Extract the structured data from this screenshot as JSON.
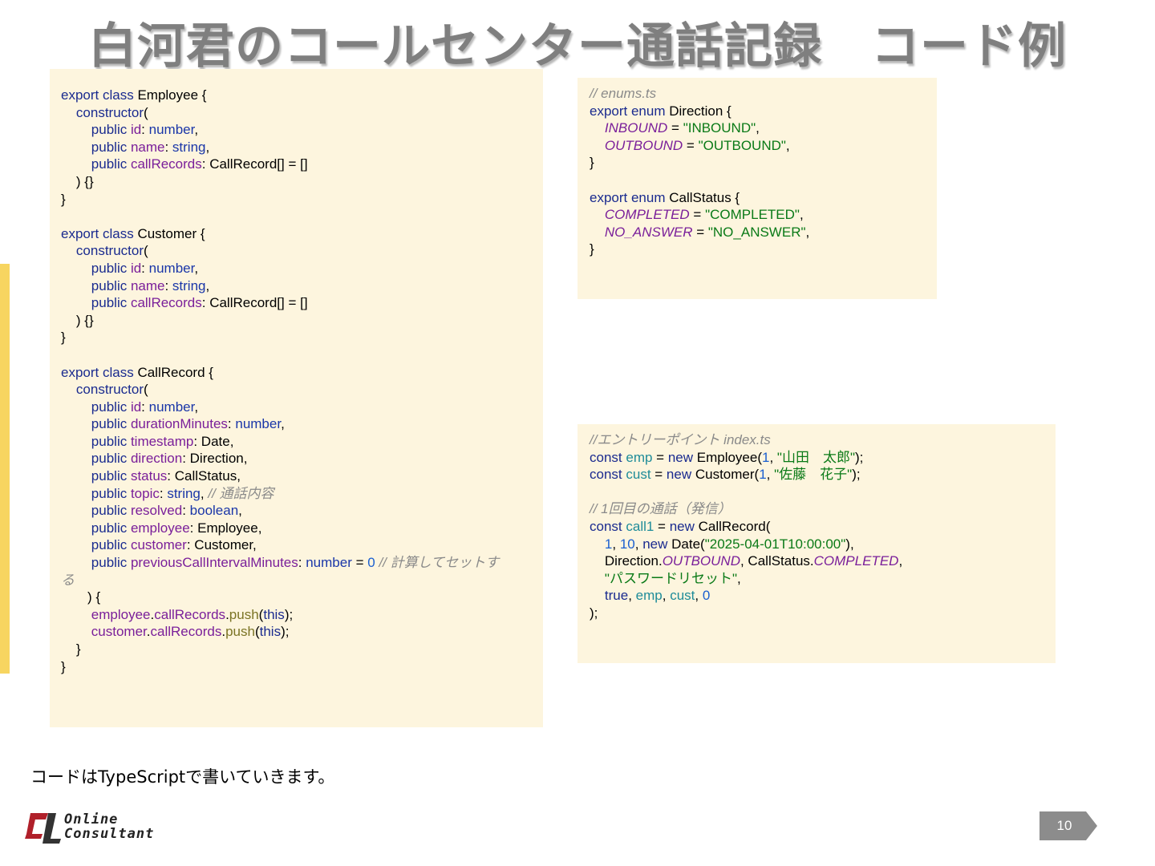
{
  "slide": {
    "title": "白河君のコールセンター通話記録　コード例",
    "caption": "コードはTypeScriptで書いていきます。",
    "page_number": "10",
    "logo": {
      "line1": "Online",
      "line2": "Consultant"
    },
    "accent_color": "#f7d560",
    "panel_color": "#fdf5de"
  },
  "code_classes": {
    "lines": [
      [
        {
          "t": "export class ",
          "c": "kw"
        },
        {
          "t": "Employee {"
        }
      ],
      [
        {
          "t": "    "
        },
        {
          "t": "constructor",
          "c": "kw"
        },
        {
          "t": "("
        }
      ],
      [
        {
          "t": "        "
        },
        {
          "t": "public ",
          "c": "kw"
        },
        {
          "t": "id",
          "c": "pr"
        },
        {
          "t": ": "
        },
        {
          "t": "number",
          "c": "ty"
        },
        {
          "t": ","
        }
      ],
      [
        {
          "t": "        "
        },
        {
          "t": "public ",
          "c": "kw"
        },
        {
          "t": "name",
          "c": "pr"
        },
        {
          "t": ": "
        },
        {
          "t": "string",
          "c": "ty"
        },
        {
          "t": ","
        }
      ],
      [
        {
          "t": "        "
        },
        {
          "t": "public ",
          "c": "kw"
        },
        {
          "t": "callRecords",
          "c": "pr"
        },
        {
          "t": ": CallRecord[] = []"
        }
      ],
      [
        {
          "t": "    ) {}"
        }
      ],
      [
        {
          "t": "}"
        }
      ],
      [],
      [
        {
          "t": "export class ",
          "c": "kw"
        },
        {
          "t": "Customer {"
        }
      ],
      [
        {
          "t": "    "
        },
        {
          "t": "constructor",
          "c": "kw"
        },
        {
          "t": "("
        }
      ],
      [
        {
          "t": "        "
        },
        {
          "t": "public ",
          "c": "kw"
        },
        {
          "t": "id",
          "c": "pr"
        },
        {
          "t": ": "
        },
        {
          "t": "number",
          "c": "ty"
        },
        {
          "t": ","
        }
      ],
      [
        {
          "t": "        "
        },
        {
          "t": "public ",
          "c": "kw"
        },
        {
          "t": "name",
          "c": "pr"
        },
        {
          "t": ": "
        },
        {
          "t": "string",
          "c": "ty"
        },
        {
          "t": ","
        }
      ],
      [
        {
          "t": "        "
        },
        {
          "t": "public ",
          "c": "kw"
        },
        {
          "t": "callRecords",
          "c": "pr"
        },
        {
          "t": ": CallRecord[] = []"
        }
      ],
      [
        {
          "t": "    ) {}"
        }
      ],
      [
        {
          "t": "}"
        }
      ],
      [],
      [
        {
          "t": "export class ",
          "c": "kw"
        },
        {
          "t": "CallRecord {"
        }
      ],
      [
        {
          "t": "    "
        },
        {
          "t": "constructor",
          "c": "kw"
        },
        {
          "t": "("
        }
      ],
      [
        {
          "t": "        "
        },
        {
          "t": "public ",
          "c": "kw"
        },
        {
          "t": "id",
          "c": "pr"
        },
        {
          "t": ": "
        },
        {
          "t": "number",
          "c": "ty"
        },
        {
          "t": ","
        }
      ],
      [
        {
          "t": "        "
        },
        {
          "t": "public ",
          "c": "kw"
        },
        {
          "t": "durationMinutes",
          "c": "pr"
        },
        {
          "t": ": "
        },
        {
          "t": "number",
          "c": "ty"
        },
        {
          "t": ","
        }
      ],
      [
        {
          "t": "        "
        },
        {
          "t": "public ",
          "c": "kw"
        },
        {
          "t": "timestamp",
          "c": "pr"
        },
        {
          "t": ": Date,"
        }
      ],
      [
        {
          "t": "        "
        },
        {
          "t": "public ",
          "c": "kw"
        },
        {
          "t": "direction",
          "c": "pr"
        },
        {
          "t": ": Direction,"
        }
      ],
      [
        {
          "t": "        "
        },
        {
          "t": "public ",
          "c": "kw"
        },
        {
          "t": "status",
          "c": "pr"
        },
        {
          "t": ": CallStatus,"
        }
      ],
      [
        {
          "t": "        "
        },
        {
          "t": "public ",
          "c": "kw"
        },
        {
          "t": "topic",
          "c": "pr"
        },
        {
          "t": ": "
        },
        {
          "t": "string",
          "c": "ty"
        },
        {
          "t": ", "
        },
        {
          "t": "// 通話内容",
          "c": "cm"
        }
      ],
      [
        {
          "t": "        "
        },
        {
          "t": "public ",
          "c": "kw"
        },
        {
          "t": "resolved",
          "c": "pr"
        },
        {
          "t": ": "
        },
        {
          "t": "boolean",
          "c": "ty"
        },
        {
          "t": ","
        }
      ],
      [
        {
          "t": "        "
        },
        {
          "t": "public ",
          "c": "kw"
        },
        {
          "t": "employee",
          "c": "pr"
        },
        {
          "t": ": Employee,"
        }
      ],
      [
        {
          "t": "        "
        },
        {
          "t": "public ",
          "c": "kw"
        },
        {
          "t": "customer",
          "c": "pr"
        },
        {
          "t": ": Customer,"
        }
      ],
      [
        {
          "t": "        "
        },
        {
          "t": "public ",
          "c": "kw"
        },
        {
          "t": "previousCallIntervalMinutes",
          "c": "pr"
        },
        {
          "t": ": "
        },
        {
          "t": "number",
          "c": "ty"
        },
        {
          "t": " = "
        },
        {
          "t": "0",
          "c": "nm"
        },
        {
          "t": " "
        },
        {
          "t": "// 計算してセットす",
          "c": "cm"
        }
      ],
      [
        {
          "t": "る",
          "c": "cm"
        }
      ],
      [
        {
          "t": "       ) {"
        }
      ],
      [
        {
          "t": "        "
        },
        {
          "t": "employee",
          "c": "pr"
        },
        {
          "t": "."
        },
        {
          "t": "callRecords",
          "c": "pr"
        },
        {
          "t": "."
        },
        {
          "t": "push",
          "c": "fn"
        },
        {
          "t": "("
        },
        {
          "t": "this",
          "c": "kw"
        },
        {
          "t": ");"
        }
      ],
      [
        {
          "t": "        "
        },
        {
          "t": "customer",
          "c": "pr"
        },
        {
          "t": "."
        },
        {
          "t": "callRecords",
          "c": "pr"
        },
        {
          "t": "."
        },
        {
          "t": "push",
          "c": "fn"
        },
        {
          "t": "("
        },
        {
          "t": "this",
          "c": "kw"
        },
        {
          "t": ");"
        }
      ],
      [
        {
          "t": "    }"
        }
      ],
      [
        {
          "t": "}"
        }
      ]
    ]
  },
  "code_enums": {
    "lines": [
      [
        {
          "t": "// enums.ts",
          "c": "cm"
        }
      ],
      [
        {
          "t": "export enum ",
          "c": "kw"
        },
        {
          "t": "Direction {"
        }
      ],
      [
        {
          "t": "    "
        },
        {
          "t": "INBOUND",
          "c": "en"
        },
        {
          "t": " = "
        },
        {
          "t": "\"INBOUND\"",
          "c": "st"
        },
        {
          "t": ","
        }
      ],
      [
        {
          "t": "    "
        },
        {
          "t": "OUTBOUND",
          "c": "en"
        },
        {
          "t": " = "
        },
        {
          "t": "\"OUTBOUND\"",
          "c": "st"
        },
        {
          "t": ","
        }
      ],
      [
        {
          "t": "}"
        }
      ],
      [],
      [
        {
          "t": "export enum ",
          "c": "kw"
        },
        {
          "t": "CallStatus {"
        }
      ],
      [
        {
          "t": "    "
        },
        {
          "t": "COMPLETED",
          "c": "en"
        },
        {
          "t": " = "
        },
        {
          "t": "\"COMPLETED\"",
          "c": "st"
        },
        {
          "t": ","
        }
      ],
      [
        {
          "t": "    "
        },
        {
          "t": "NO_ANSWER",
          "c": "en"
        },
        {
          "t": " = "
        },
        {
          "t": "\"NO_ANSWER\"",
          "c": "st"
        },
        {
          "t": ","
        }
      ],
      [
        {
          "t": "}"
        }
      ]
    ]
  },
  "code_index": {
    "lines": [
      [
        {
          "t": "//エントリーポイント index.ts",
          "c": "cm"
        }
      ],
      [
        {
          "t": "const ",
          "c": "kw"
        },
        {
          "t": "emp",
          "c": "va"
        },
        {
          "t": " = "
        },
        {
          "t": "new ",
          "c": "kw"
        },
        {
          "t": "Employee("
        },
        {
          "t": "1",
          "c": "nm"
        },
        {
          "t": ", "
        },
        {
          "t": "\"山田　太郎\"",
          "c": "st"
        },
        {
          "t": ");"
        }
      ],
      [
        {
          "t": "const ",
          "c": "kw"
        },
        {
          "t": "cust",
          "c": "va"
        },
        {
          "t": " = "
        },
        {
          "t": "new ",
          "c": "kw"
        },
        {
          "t": "Customer("
        },
        {
          "t": "1",
          "c": "nm"
        },
        {
          "t": ", "
        },
        {
          "t": "\"佐藤　花子\"",
          "c": "st"
        },
        {
          "t": ");"
        }
      ],
      [],
      [
        {
          "t": "// 1回目の通話（発信）",
          "c": "cm"
        }
      ],
      [
        {
          "t": "const ",
          "c": "kw"
        },
        {
          "t": "call1",
          "c": "va"
        },
        {
          "t": " = "
        },
        {
          "t": "new ",
          "c": "kw"
        },
        {
          "t": "CallRecord("
        }
      ],
      [
        {
          "t": "    "
        },
        {
          "t": "1",
          "c": "nm"
        },
        {
          "t": ", "
        },
        {
          "t": "10",
          "c": "nm"
        },
        {
          "t": ", "
        },
        {
          "t": "new ",
          "c": "kw"
        },
        {
          "t": "Date("
        },
        {
          "t": "\"2025-04-01T10:00:00\"",
          "c": "st"
        },
        {
          "t": "),"
        }
      ],
      [
        {
          "t": "    Direction."
        },
        {
          "t": "OUTBOUND",
          "c": "en"
        },
        {
          "t": ", CallStatus."
        },
        {
          "t": "COMPLETED",
          "c": "en"
        },
        {
          "t": ","
        }
      ],
      [
        {
          "t": "    "
        },
        {
          "t": "\"パスワードリセット\"",
          "c": "st"
        },
        {
          "t": ","
        }
      ],
      [
        {
          "t": "    "
        },
        {
          "t": "true",
          "c": "kw"
        },
        {
          "t": ", "
        },
        {
          "t": "emp",
          "c": "va"
        },
        {
          "t": ", "
        },
        {
          "t": "cust",
          "c": "va"
        },
        {
          "t": ", "
        },
        {
          "t": "0",
          "c": "nm"
        }
      ],
      [
        {
          "t": ");"
        }
      ]
    ]
  }
}
